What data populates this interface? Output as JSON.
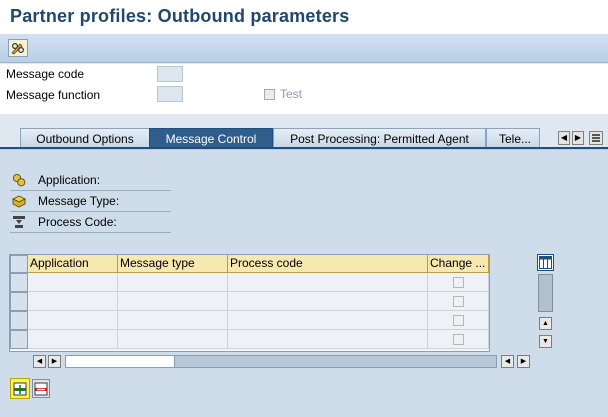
{
  "title": "Partner profiles: Outbound parameters",
  "header": {
    "message_code_label": "Message code",
    "message_function_label": "Message function",
    "test_label": "Test",
    "test_checked": false
  },
  "tabs": [
    {
      "label": "Outbound Options",
      "active": false
    },
    {
      "label": "Message Control",
      "active": true
    },
    {
      "label": "Post Processing: Permitted Agent",
      "active": false
    },
    {
      "label": "Tele...",
      "active": false
    }
  ],
  "info": {
    "application_label": "Application:",
    "message_type_label": "Message Type:",
    "process_code_label": "Process Code:"
  },
  "table": {
    "columns": [
      "Application",
      "Message type",
      "Process code",
      "Change ..."
    ],
    "rows": [
      {
        "application": "",
        "message_type": "",
        "process_code": "",
        "change": false
      },
      {
        "application": "",
        "message_type": "",
        "process_code": "",
        "change": false
      },
      {
        "application": "",
        "message_type": "",
        "process_code": "",
        "change": false
      },
      {
        "application": "",
        "message_type": "",
        "process_code": "",
        "change": false
      }
    ]
  },
  "icons": {
    "toolbar_display_change": "pencil-glasses-icon",
    "application": "application-icon",
    "message_type": "message-type-icon",
    "process_code": "process-code-icon",
    "table_settings": "table-settings-icon",
    "insert_entry": "insert-row-icon",
    "delete_entry": "delete-row-icon"
  },
  "colors": {
    "title_text": "#22476e",
    "active_tab": "#2f5e8d",
    "panel": "#cfdce9",
    "header_cells": "#f7e8b0",
    "highlight": "#fff34a"
  }
}
